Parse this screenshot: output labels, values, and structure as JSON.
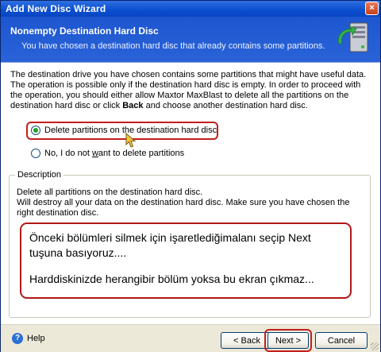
{
  "window": {
    "title": "Add New Disc Wizard",
    "close_label": "×"
  },
  "header": {
    "title": "Nonempty Destination Hard Disc",
    "subtitle": "You have chosen a destination hard disc that already contains some partitions."
  },
  "intro": {
    "line1": "The destination drive you have chosen contains some partitions that might have useful data.",
    "line2": "The operation is possible only if the destination hard disc is empty. In order to proceed with",
    "line3": "the operation, you should either allow Maxtor MaxBlast to delete all the partitions on the",
    "line4_pre": "destination hard disc or click ",
    "line4_bold": "Back",
    "line4_post": " and choose another destination hard disc."
  },
  "options": {
    "delete_label": "Delete partitions on the destination hard disc",
    "keep_label_pre": "No, I do not ",
    "keep_label_u": "w",
    "keep_label_post": "ant to delete partitions",
    "selected": "delete"
  },
  "description": {
    "legend": "Description",
    "line1": "Delete all partitions on the destination hard disc.",
    "line2": "Will destroy all your data on the destination hard disc. Make sure you have chosen the",
    "line3": "right destination disc."
  },
  "callout": {
    "line1": "Önceki bölümleri silmek için işaretlediğimalanı seçip Next",
    "line2": "tuşuna basıyoruz....",
    "line3": "Harddiskinizde herangibir bölüm yoksa bu ekran çıkmaz..."
  },
  "footer": {
    "help_label": "Help",
    "back_label": "< Back",
    "next_label": "Next >",
    "cancel_label": "Cancel"
  },
  "colors": {
    "title_bar": "#0a4fd0",
    "header": "#2a63d8",
    "highlight": "#c41e1e",
    "radio_selected": "#22a022"
  }
}
